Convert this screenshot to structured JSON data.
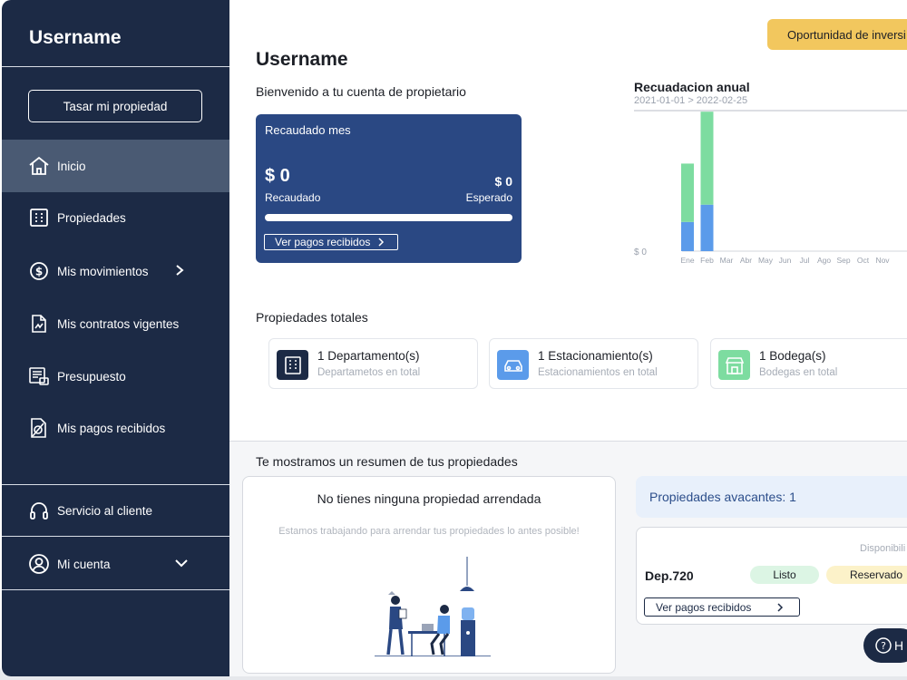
{
  "sidebar": {
    "username": "Username",
    "rate_button": "Tasar mi propiedad",
    "items": [
      {
        "label": "Inicio"
      },
      {
        "label": "Propiedades"
      },
      {
        "label": "Mis movimientos"
      },
      {
        "label": "Mis contratos vigentes"
      },
      {
        "label": "Presupuesto"
      },
      {
        "label": "Mis pagos recibidos"
      }
    ],
    "customer_service": "Servicio al cliente",
    "account": "Mi cuenta"
  },
  "header": {
    "investment_button": "Oportunidad de inversi",
    "title": "Username",
    "subtitle": "Bienvenido a tu cuenta de propietario"
  },
  "collected_card": {
    "title": "Recaudado mes",
    "collected_amount": "$ 0",
    "collected_label": "Recaudado",
    "expected_amount": "$ 0",
    "expected_label": "Esperado",
    "progress": 0,
    "link_label": "Ver pagos recibidos"
  },
  "chart_data": {
    "type": "bar",
    "title": "Recuadacion anual",
    "subtitle": "2021-01-01 > 2022-02-25",
    "y_tick_label": "$ 0",
    "categories": [
      "Ene",
      "Feb",
      "Mar",
      "Abr",
      "May",
      "Jun",
      "Jul",
      "Ago",
      "Sep",
      "Oct",
      "Nov"
    ],
    "series": [
      {
        "color": "#5b9bea",
        "values": [
          27,
          43,
          0,
          0,
          0,
          0,
          0,
          0,
          0,
          0,
          0
        ]
      },
      {
        "color": "#7ddca0",
        "values": [
          54,
          86,
          0,
          0,
          0,
          0,
          0,
          0,
          0,
          0,
          0
        ]
      }
    ],
    "ylim": [
      0,
      130
    ]
  },
  "properties": {
    "title": "Propiedades totales",
    "cards": [
      {
        "name": "1 Departamento(s)",
        "desc": "Departametos en total",
        "icon": "building-icon",
        "color": "#1c2a45"
      },
      {
        "name": "1 Estacionamiento(s)",
        "desc": "Estacionamientos en total",
        "icon": "car-icon",
        "color": "#5b9bea"
      },
      {
        "name": "1 Bodega(s)",
        "desc": "Bodegas en total",
        "icon": "store-icon",
        "color": "#7ddca0"
      }
    ]
  },
  "summary": {
    "title": "Te mostramos un resumen de tus propiedades",
    "empty_title": "No tienes ninguna propiedad arrendada",
    "empty_desc": "Estamos trabajando para arrendar tus propiedades lo antes posible!",
    "vacant_label": "Propiedades avacantes: 1",
    "availability_label": "Disponibili",
    "dep_name": "Dep.720",
    "tag_ready": "Listo",
    "tag_reserved": "Reservado",
    "link_label": "Ver pagos recibidos",
    "help_label": "H"
  }
}
